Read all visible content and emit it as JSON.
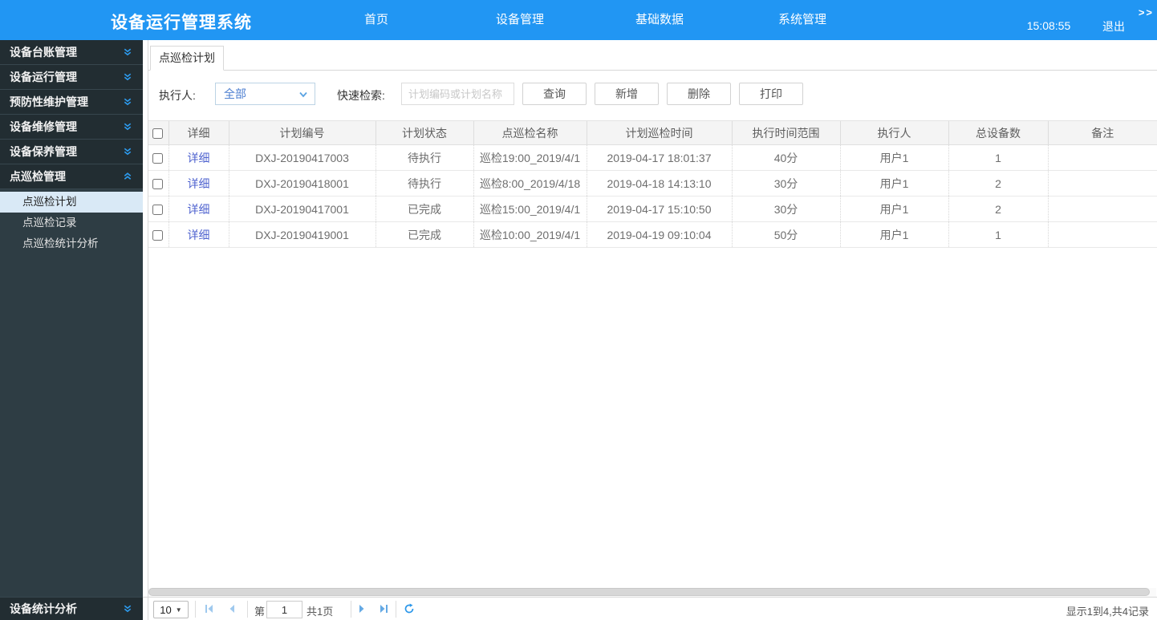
{
  "header": {
    "title": "设备运行管理系统",
    "nav": [
      {
        "label": "首页"
      },
      {
        "label": "设备管理"
      },
      {
        "label": "基础数据"
      },
      {
        "label": "系统管理"
      }
    ],
    "time": "15:08:55",
    "logout": "退出",
    "collapse": ">>"
  },
  "sidebar": {
    "items": [
      {
        "label": "设备台账管理"
      },
      {
        "label": "设备运行管理"
      },
      {
        "label": "预防性维护管理"
      },
      {
        "label": "设备维修管理"
      },
      {
        "label": "设备保养管理"
      },
      {
        "label": "点巡检管理"
      }
    ],
    "submenu": [
      {
        "label": "点巡检计划",
        "active": true
      },
      {
        "label": "点巡检记录",
        "active": false
      },
      {
        "label": "点巡检统计分析",
        "active": false
      }
    ],
    "bottom_item": {
      "label": "设备统计分析"
    }
  },
  "tab": {
    "label": "点巡检计划"
  },
  "filters": {
    "executor_label": "执行人:",
    "executor_value": "全部",
    "search_label": "快速检索:",
    "search_placeholder": "计划编码或计划名称",
    "buttons": [
      {
        "label": "查询"
      },
      {
        "label": "新增"
      },
      {
        "label": "删除"
      },
      {
        "label": "打印"
      }
    ]
  },
  "table": {
    "columns": [
      "详细",
      "计划编号",
      "计划状态",
      "点巡检名称",
      "计划巡检时间",
      "执行时间范围",
      "执行人",
      "总设备数",
      "备注"
    ],
    "rows": [
      {
        "detail": "详细",
        "plan_no": "DXJ-20190417003",
        "status": "待执行",
        "name": "巡检19:00_2019/4/1",
        "time": "2019-04-17 18:01:37",
        "range": "40分",
        "executor": "用户1",
        "devices": "1",
        "remark": ""
      },
      {
        "detail": "详细",
        "plan_no": "DXJ-20190418001",
        "status": "待执行",
        "name": "巡检8:00_2019/4/18",
        "time": "2019-04-18 14:13:10",
        "range": "30分",
        "executor": "用户1",
        "devices": "2",
        "remark": ""
      },
      {
        "detail": "详细",
        "plan_no": "DXJ-20190417001",
        "status": "已完成",
        "name": "巡检15:00_2019/4/1",
        "time": "2019-04-17 15:10:50",
        "range": "30分",
        "executor": "用户1",
        "devices": "2",
        "remark": ""
      },
      {
        "detail": "详细",
        "plan_no": "DXJ-20190419001",
        "status": "已完成",
        "name": "巡检10:00_2019/4/1",
        "time": "2019-04-19 09:10:04",
        "range": "50分",
        "executor": "用户1",
        "devices": "1",
        "remark": ""
      }
    ]
  },
  "pagination": {
    "page_size": "10",
    "page_prefix": "第",
    "page_value": "1",
    "page_suffix": "共1页",
    "summary": "显示1到4,共4记录"
  }
}
